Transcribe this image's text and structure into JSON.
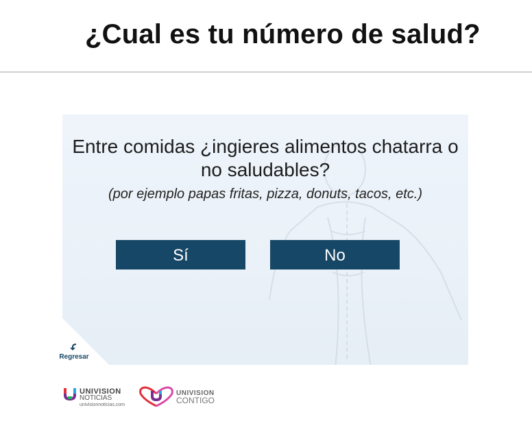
{
  "header": {
    "title": "¿Cual es tu número de salud?"
  },
  "quiz": {
    "question": "Entre comidas ¿ingieres alimentos chatarra o no saludables?",
    "hint": "(por ejemplo papas fritas, pizza, donuts, tacos, etc.)",
    "options": {
      "yes": "Sí",
      "no": "No"
    },
    "back_label": "Regresar"
  },
  "footer": {
    "logo1": {
      "name": "UNIVISION",
      "sub": "NOTICIAS",
      "url": "univisionnoticias.com"
    },
    "logo2": {
      "name": "UNIVISION",
      "sub": "CONTIGO"
    }
  },
  "colors": {
    "button": "#174766",
    "panel": "#eaf1f8",
    "divider": "#cfcfcf"
  }
}
